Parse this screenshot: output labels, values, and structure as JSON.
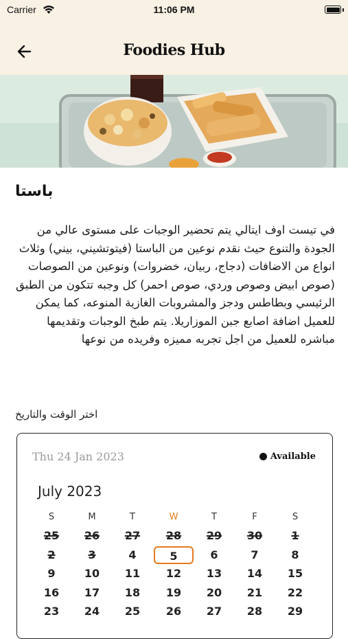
{
  "status": {
    "carrier": "Carrier",
    "time": "11:06 PM"
  },
  "nav": {
    "title": "Foodies Hub"
  },
  "dish": {
    "title": "باستا",
    "description": "في تيست اوف ايتالي يتم تحضير الوجبات على مستوى عالي من الجودة والتنوع حيث نقدم نوعين من الباستا (فيتوتشيني، بيني) وثلاث انواع من الاضافات (دجاج، ربيان، خضروات) ونوعين من الصوصات (صوص ابيض وصوص وردي، صوص احمر) كل وجبه تتكون من الطبق الرئيسي وبطاطس ودجز والمشروبات الغازية المنوعه، كما يمكن للعميل اضافة اصابع جبن الموزاريلا. يتم طبخ الوجبات وتقديمها مباشره للعميل من اجل تجربه مميزه وفريده من نوعها"
  },
  "booking": {
    "label": "اختر الوقت والتاريخ"
  },
  "calendar": {
    "selected_date": "Thu 24 Jan 2023",
    "legend": "Available",
    "month": "July 2023",
    "weekdays": [
      "S",
      "M",
      "T",
      "W",
      "T",
      "F",
      "S"
    ],
    "today_index": 3,
    "weeks": [
      [
        {
          "d": "25",
          "past": true
        },
        {
          "d": "26",
          "past": true
        },
        {
          "d": "27",
          "past": true
        },
        {
          "d": "28",
          "past": true
        },
        {
          "d": "29",
          "past": true
        },
        {
          "d": "30",
          "past": true
        },
        {
          "d": "1",
          "past": true
        }
      ],
      [
        {
          "d": "2",
          "past": true
        },
        {
          "d": "3",
          "past": true
        },
        {
          "d": "4"
        },
        {
          "d": "5",
          "selected": true
        },
        {
          "d": "6"
        },
        {
          "d": "7"
        },
        {
          "d": "8"
        }
      ],
      [
        {
          "d": "9"
        },
        {
          "d": "10"
        },
        {
          "d": "11"
        },
        {
          "d": "12"
        },
        {
          "d": "13"
        },
        {
          "d": "14"
        },
        {
          "d": "15"
        }
      ],
      [
        {
          "d": "16"
        },
        {
          "d": "17"
        },
        {
          "d": "18"
        },
        {
          "d": "19"
        },
        {
          "d": "20"
        },
        {
          "d": "21"
        },
        {
          "d": "22"
        }
      ],
      [
        {
          "d": "23"
        },
        {
          "d": "24"
        },
        {
          "d": "25"
        },
        {
          "d": "26"
        },
        {
          "d": "27"
        },
        {
          "d": "28"
        },
        {
          "d": "29"
        }
      ]
    ]
  },
  "icons": {
    "back": "arrow-left-icon",
    "wifi": "wifi-icon",
    "battery": "battery-icon"
  },
  "colors": {
    "header_bg": "#f8f1e4",
    "accent": "#e77b1f"
  }
}
